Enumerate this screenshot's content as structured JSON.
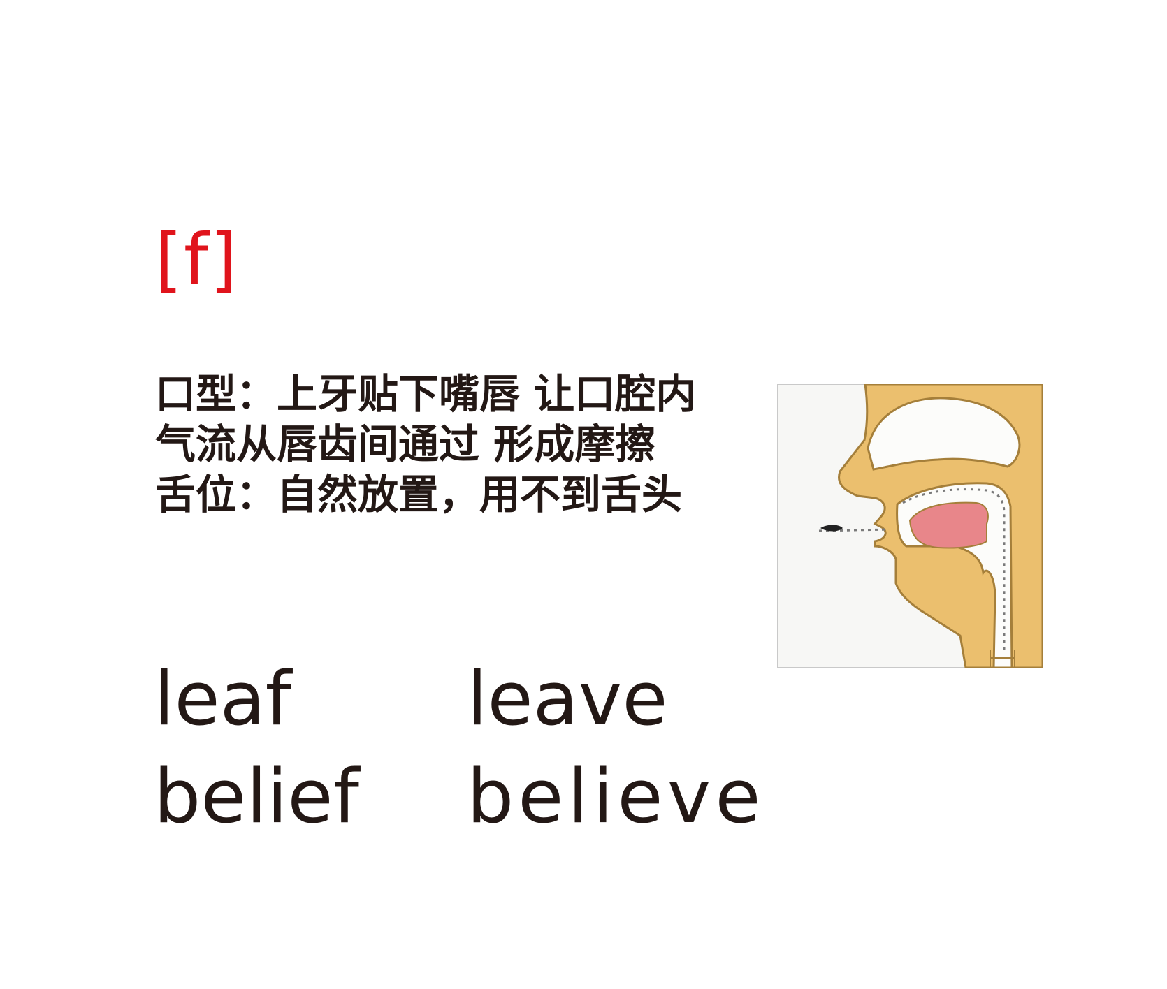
{
  "phoneme": "[f]",
  "description": {
    "line1": "口型：上牙贴下嘴唇  让口腔内",
    "line2": "气流从唇齿间通过  形成摩擦",
    "line3": "舌位：自然放置，用不到舌头"
  },
  "words": {
    "leaf": "leaf",
    "leave": "leave",
    "belief": "belief",
    "believe": "believe"
  },
  "colors": {
    "phoneme": "#e0141c",
    "text": "#231815",
    "skin": "#ebbf6e",
    "tongue": "#e8868a",
    "outline": "#a57f3a"
  }
}
